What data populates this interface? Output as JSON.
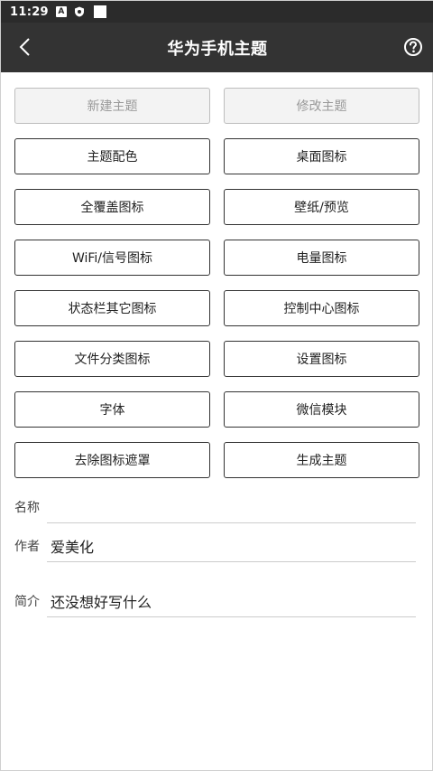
{
  "status_bar": {
    "time": "11:29",
    "icons": [
      "a-notification-icon",
      "shield-icon",
      "square-icon"
    ],
    "a_glyph": "A"
  },
  "app_bar": {
    "title": "华为手机主题",
    "back_icon": "chevron-left-icon",
    "help_icon": "help-circle-icon"
  },
  "buttons": [
    {
      "label": "新建主题",
      "enabled": false
    },
    {
      "label": "修改主题",
      "enabled": false
    },
    {
      "label": "主题配色",
      "enabled": true
    },
    {
      "label": "桌面图标",
      "enabled": true
    },
    {
      "label": "全覆盖图标",
      "enabled": true
    },
    {
      "label": "壁纸/预览",
      "enabled": true
    },
    {
      "label": "WiFi/信号图标",
      "enabled": true
    },
    {
      "label": "电量图标",
      "enabled": true
    },
    {
      "label": "状态栏其它图标",
      "enabled": true
    },
    {
      "label": "控制中心图标",
      "enabled": true
    },
    {
      "label": "文件分类图标",
      "enabled": true
    },
    {
      "label": "设置图标",
      "enabled": true
    },
    {
      "label": "字体",
      "enabled": true
    },
    {
      "label": "微信模块",
      "enabled": true
    },
    {
      "label": "去除图标遮罩",
      "enabled": true
    },
    {
      "label": "生成主题",
      "enabled": true
    }
  ],
  "fields": {
    "name": {
      "label": "名称",
      "value": ""
    },
    "author": {
      "label": "作者",
      "value": "爱美化"
    },
    "intro": {
      "label": "简介",
      "value": "还没想好写什么"
    }
  },
  "colors": {
    "status_bar": "#2b2b2b",
    "app_bar": "#333333",
    "button_border": "#333333",
    "disabled_bg": "#f3f3f3"
  }
}
